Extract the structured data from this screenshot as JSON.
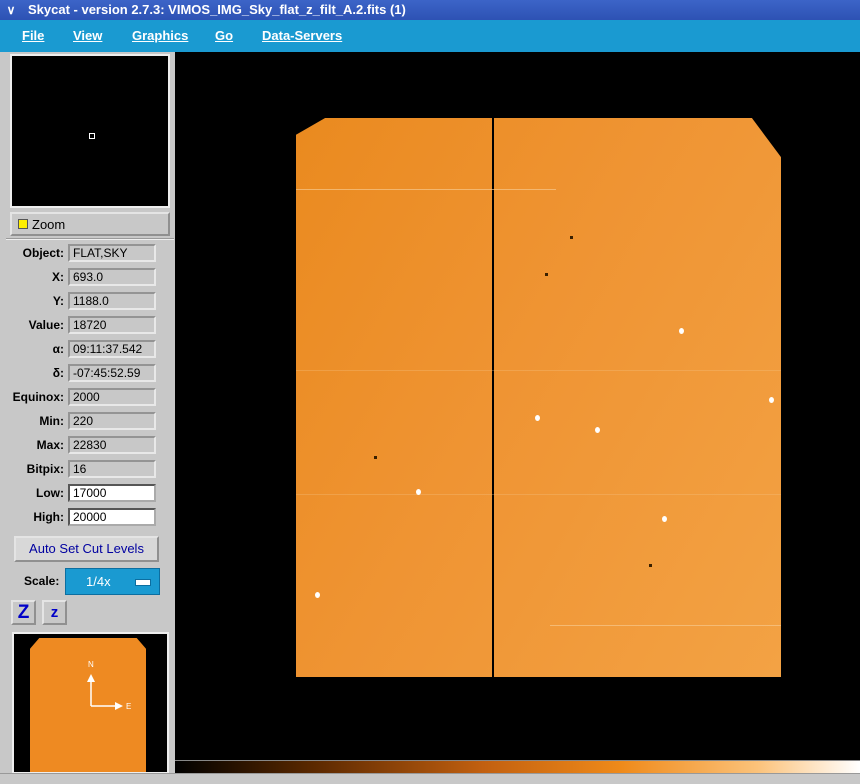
{
  "window": {
    "title": "Skycat - version 2.7.3: VIMOS_IMG_Sky_flat_z_filt_A.2.fits (1)"
  },
  "menu": [
    {
      "label": "File"
    },
    {
      "label": "View"
    },
    {
      "label": "Graphics"
    },
    {
      "label": "Go"
    },
    {
      "label": "Data-Servers"
    }
  ],
  "zoom": {
    "label": "Zoom"
  },
  "info": {
    "object": {
      "label": "Object:",
      "value": "FLAT,SKY"
    },
    "x": {
      "label": "X:",
      "value": "693.0"
    },
    "y": {
      "label": "Y:",
      "value": "1188.0"
    },
    "value": {
      "label": "Value:",
      "value": "18720"
    },
    "alpha": {
      "label": "α:",
      "value": "09:11:37.542"
    },
    "delta": {
      "label": "δ:",
      "value": "-07:45:52.59"
    },
    "equinox": {
      "label": "Equinox:",
      "value": "2000"
    },
    "min": {
      "label": "Min:",
      "value": "220"
    },
    "max": {
      "label": "Max:",
      "value": "22830"
    },
    "bitpix": {
      "label": "Bitpix:",
      "value": "16"
    },
    "low": {
      "label": "Low:",
      "value": "17000"
    },
    "high": {
      "label": "High:",
      "value": "20000"
    }
  },
  "cut_button": {
    "label": "Auto Set Cut Levels"
  },
  "scale": {
    "label": "Scale:",
    "value": "1/4x"
  },
  "zoom_buttons": {
    "in": "Z",
    "out": "z"
  },
  "compass": {
    "north": "N",
    "east": "E"
  },
  "colors": {
    "accent": "#1a9ad1",
    "image": "#ee8a22",
    "title": "#2d52b4"
  }
}
